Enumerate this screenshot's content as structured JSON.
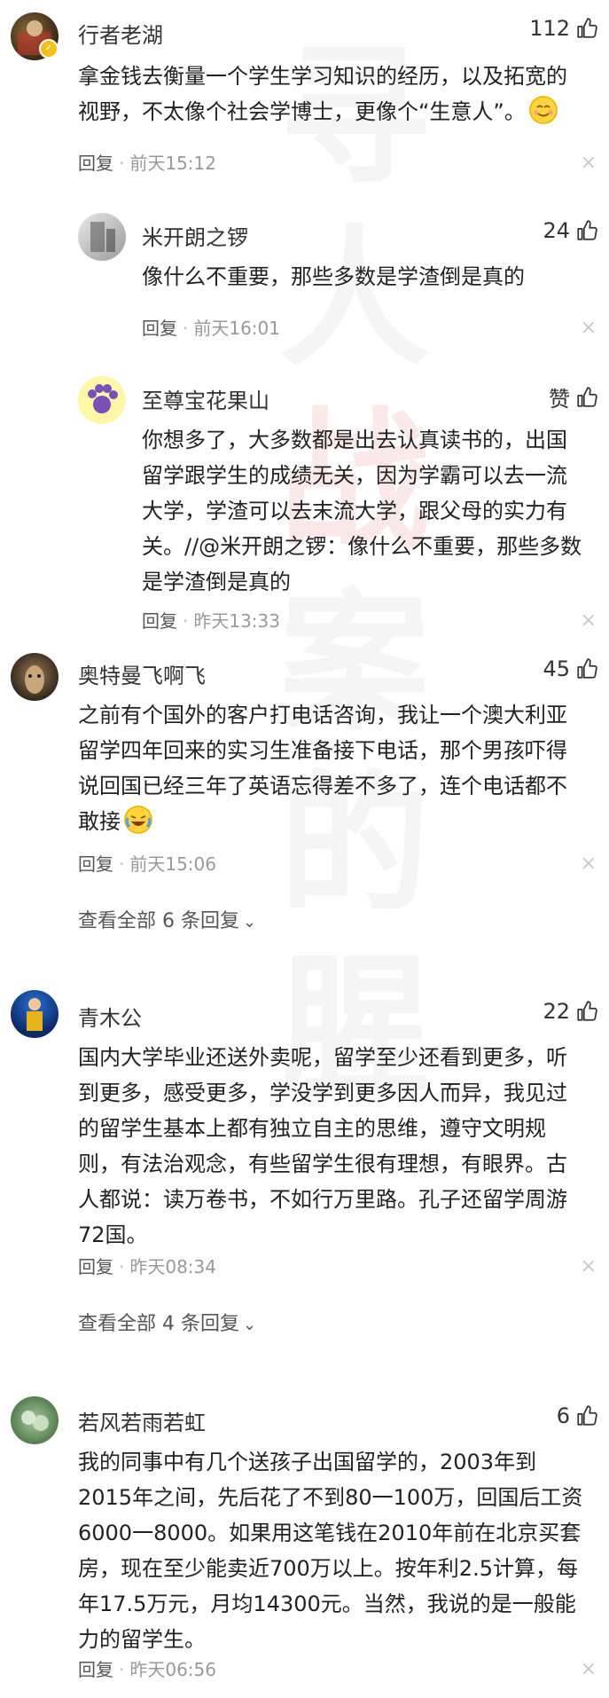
{
  "watermark": [
    "寻",
    "人",
    "战",
    "案",
    "的",
    "腥"
  ],
  "comments": [
    {
      "author": "行者老湖",
      "likes": "112",
      "text": "拿金钱去衡量一个学生学习知识的经历，以及拓宽的视野，不太像个社会学博士，更像个“生意人”。",
      "emoji": "smile-emoji",
      "reply_label": "回复",
      "time": "前天15:12"
    },
    {
      "author": "米开朗之锣",
      "likes": "24",
      "text": "像什么不重要，那些多数是学渣倒是真的",
      "reply_label": "回复",
      "time": "前天16:01"
    },
    {
      "author": "至尊宝花果山",
      "likes": "赞",
      "text": "你想多了，大多数都是出去认真读书的，出国留学跟学生的成绩无关，因为学霸可以去一流大学，学渣可以去末流大学，跟父母的实力有关。//@米开朗之锣：像什么不重要，那些多数是学渣倒是真的",
      "reply_label": "回复",
      "time": "昨天13:33"
    },
    {
      "author": "奥特曼飞啊飞",
      "likes": "45",
      "text": "之前有个国外的客户打电话咨询，我让一个澳大利亚留学四年回来的实习生准备接下电话，那个男孩吓得说回国已经三年了英语忘得差不多了，连个电话都不敢接",
      "emoji": "laugh-cry-emoji",
      "reply_label": "回复",
      "time": "前天15:06",
      "view_all": "查看全部 6 条回复"
    },
    {
      "author": "青木公",
      "likes": "22",
      "text": "国内大学毕业还送外卖呢，留学至少还看到更多，听到更多，感受更多，学没学到更多因人而异，我见过的留学生基本上都有独立自主的思维，遵守文明规则，有法治观念，有些留学生很有理想，有眼界。古人都说：读万卷书，不如行万里路。孔子还留学周游72国。",
      "reply_label": "回复",
      "time": "昨天08:34",
      "view_all": "查看全部 4 条回复"
    },
    {
      "author": "若风若雨若虹",
      "likes": "6",
      "text": "我的同事中有几个送孩子出国留学的，2003年到2015年之间，先后花了不到80一100万，回国后工资6000一8000。如果用这笔钱在2010年前在北京买套房，现在至少能卖近700万以上。按年利2.5计算，每年17.5万元，月均14300元。当然，我说的是一般能力的留学生。",
      "reply_label": "回复",
      "time": "昨天06:56"
    }
  ],
  "colors": {
    "text": "#222222",
    "meta": "#999999",
    "watermark_red": "#dc2828"
  }
}
